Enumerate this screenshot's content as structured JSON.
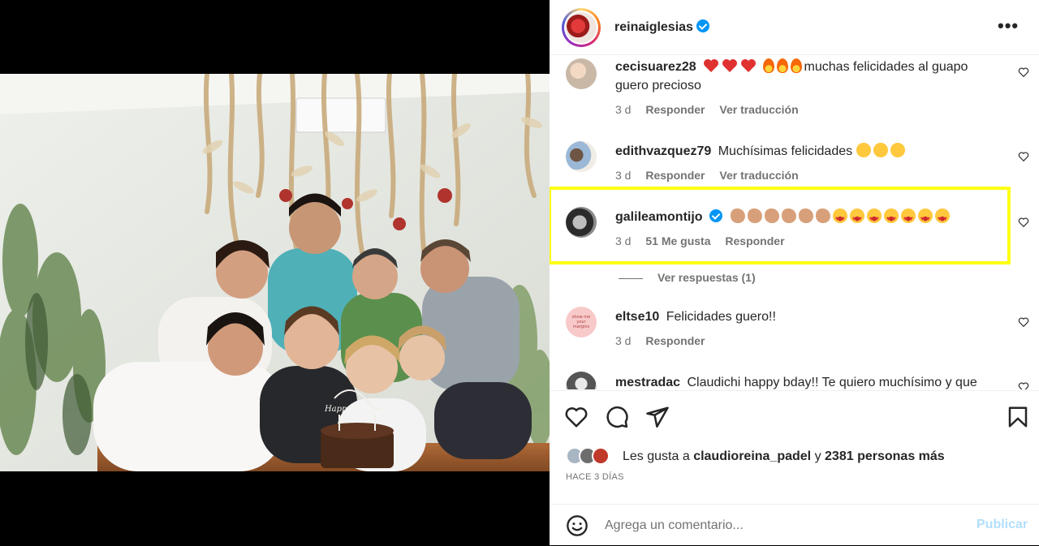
{
  "post": {
    "owner": "reinaiglesias",
    "more_icon": "more-horizontal-icon"
  },
  "comments": [
    {
      "username": "cecisuarez28",
      "text_line1": "muchas felicidades al guapo",
      "text_line2": "guero precioso",
      "time": "3 d",
      "reply": "Responder",
      "translate": "Ver traducción",
      "emojis": "❤❤❤🔥🔥🔥"
    },
    {
      "username": "edithvazquez79",
      "text": "Muchísimas felicidades",
      "time": "3 d",
      "reply": "Responder",
      "translate": "Ver traducción",
      "emojis": "🥳🥳🥳"
    },
    {
      "username": "galileamontijo",
      "verified": true,
      "time": "3 d",
      "likes": "51 Me gusta",
      "reply": "Responder",
      "emojis": "👏🏽👏🏽👏🏽👏🏽👏🏽👏🏽😍😍😍😍😍😍😍"
    },
    {
      "username": "eltse10",
      "text": "Felicidades guero!!",
      "time": "3 d",
      "reply": "Responder"
    },
    {
      "username": "mestradac",
      "text": "Claudichi happy bday!! Te quiero muchísimo y que"
    }
  ],
  "view_replies": "Ver respuestas (1)",
  "avatar_eltse10_text": "show me your margins",
  "likes": {
    "prefix": "Les gusta a",
    "user": "claudioreina_padel",
    "conj": "y",
    "count_text": "2381 personas más"
  },
  "timestamp": "HACE 3 DÍAS",
  "composer": {
    "placeholder": "Agrega un comentario...",
    "publish": "Publicar"
  },
  "photo_cake_text": "Happy Birthday",
  "colors": {
    "highlight": "#ffff14",
    "verified": "#0095f6",
    "publish_disabled": "#b2dffc",
    "secondary_text": "#737373"
  }
}
